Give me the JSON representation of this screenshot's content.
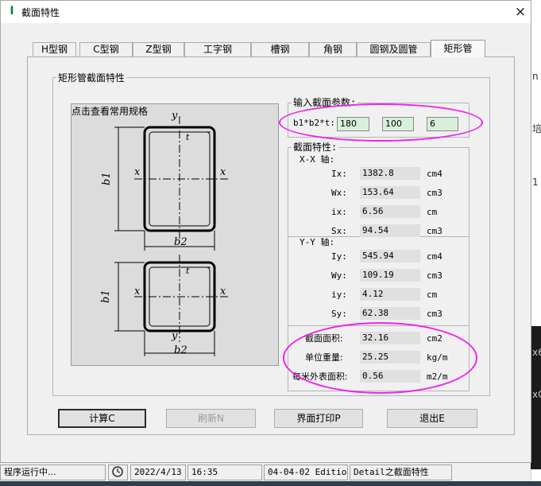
{
  "window": {
    "title": "截面特性",
    "close_symbol": "×"
  },
  "tabs": [
    "H型钢",
    "C型钢",
    "Z型钢",
    "工字钢",
    "槽钢",
    "角钢",
    "圆钢及圆管",
    "矩形管"
  ],
  "group_title": "矩形管截面特性",
  "drawing": {
    "caption": "点击查看常用规格"
  },
  "input_params": {
    "title": "输入截面参数:",
    "label": "b1*b2*t:",
    "b1": "180",
    "b2": "100",
    "t": "6"
  },
  "props": {
    "title": "截面特性:",
    "xx_title": "X-X 轴:",
    "yy_title": "Y-Y 轴:",
    "xx": [
      {
        "label": "Ix:",
        "value": "1382.8",
        "unit": "cm4"
      },
      {
        "label": "Wx:",
        "value": "153.64",
        "unit": "cm3"
      },
      {
        "label": "ix:",
        "value": "6.56",
        "unit": "cm"
      },
      {
        "label": "Sx:",
        "value": "94.54",
        "unit": "cm3"
      }
    ],
    "yy": [
      {
        "label": "Iy:",
        "value": "545.94",
        "unit": "cm4"
      },
      {
        "label": "Wy:",
        "value": "109.19",
        "unit": "cm3"
      },
      {
        "label": "iy:",
        "value": "4.12",
        "unit": "cm"
      },
      {
        "label": "Sy:",
        "value": "62.38",
        "unit": "cm3"
      }
    ],
    "misc": [
      {
        "label": "截面面积:",
        "value": "32.16",
        "unit": "cm2"
      },
      {
        "label": "单位重量:",
        "value": "25.25",
        "unit": "kg/m"
      },
      {
        "label": "每米外表面积:",
        "value": "0.56",
        "unit": "m2/m"
      }
    ]
  },
  "buttons": {
    "calc": "计算C",
    "refresh": "刷新N",
    "print": "界面打印P",
    "exit": "退出E"
  },
  "status": {
    "running": "程序运行中...",
    "date": "2022/4/13",
    "time": "16:35",
    "edition": "04-04-02 Edition",
    "detail": "Detail之截面特性"
  },
  "figure_labels": {
    "y": "y",
    "x": "x",
    "t": "t",
    "b1": "b1",
    "b2": "b2"
  },
  "background_chars": [
    "n",
    "培",
    "1",
    "x6",
    "xG"
  ],
  "colors": {
    "highlight": "#ee22ee",
    "input_bg": "#d8efdb"
  }
}
